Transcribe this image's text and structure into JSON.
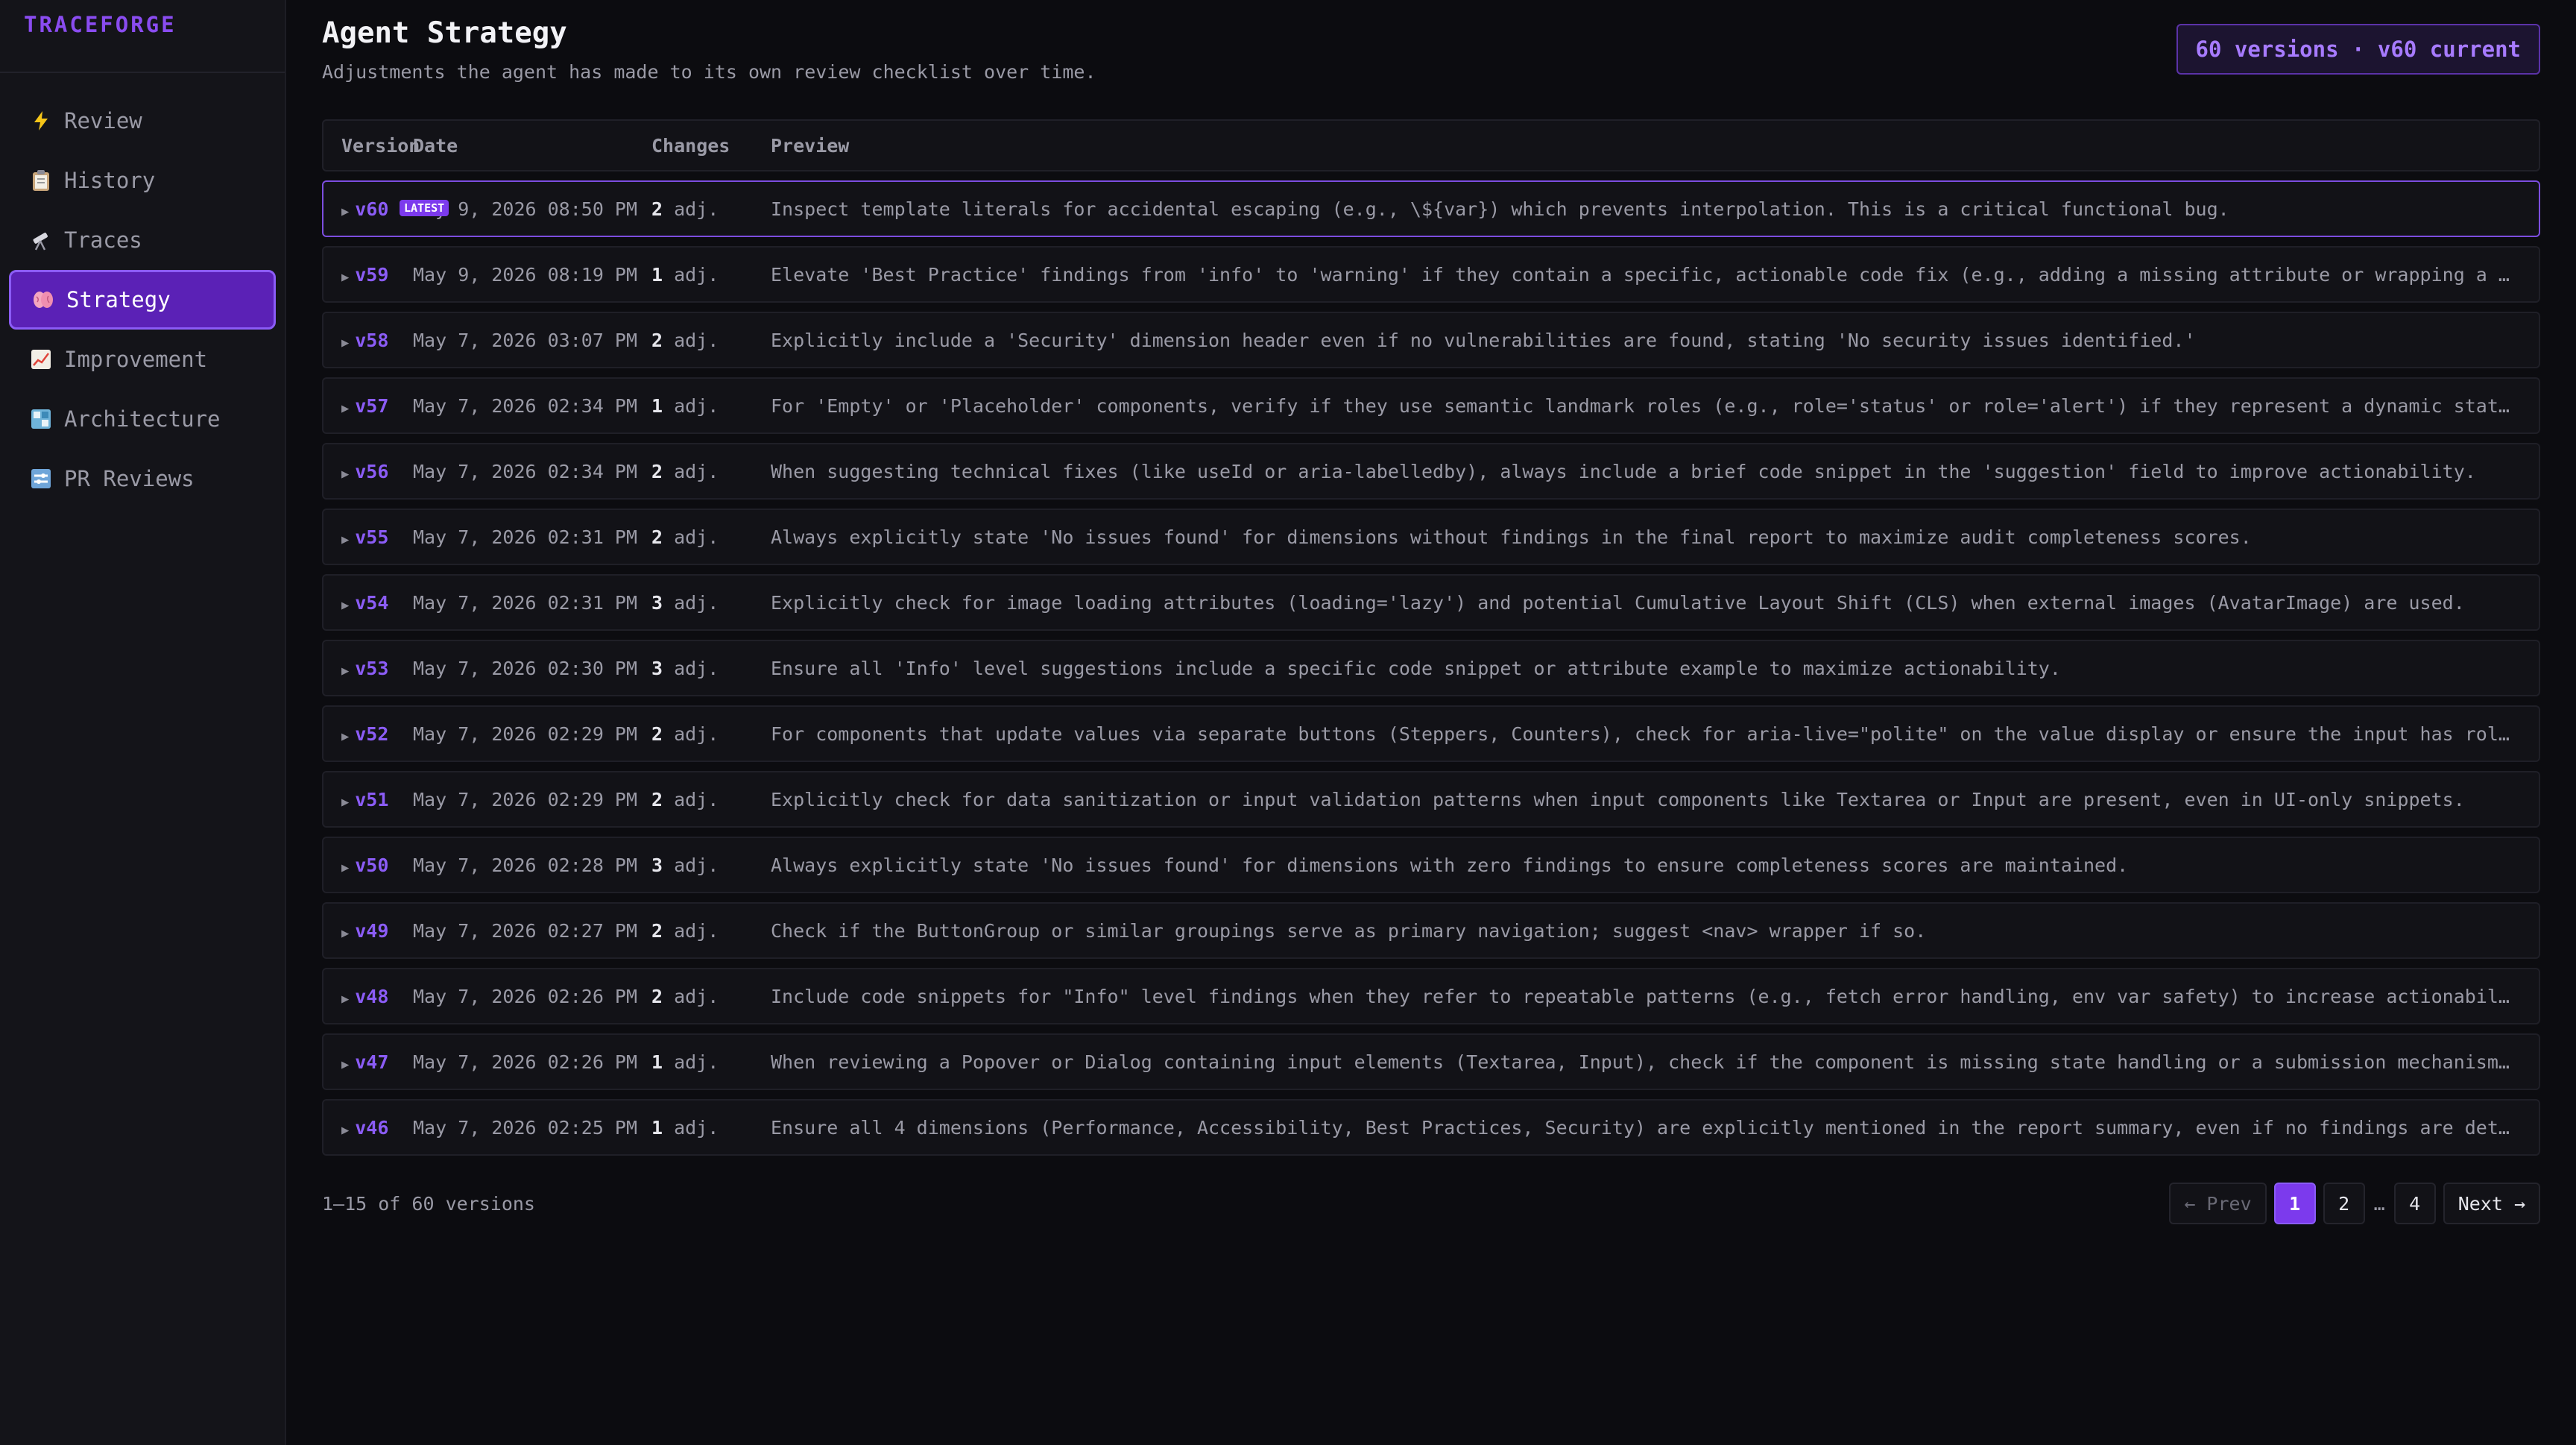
{
  "brand": "TRACEFORGE",
  "nav": [
    {
      "label": "Review",
      "icon": "lightning-icon"
    },
    {
      "label": "History",
      "icon": "clipboard-icon"
    },
    {
      "label": "Traces",
      "icon": "telescope-icon"
    },
    {
      "label": "Strategy",
      "icon": "brain-icon",
      "active": true
    },
    {
      "label": "Improvement",
      "icon": "chart-up-icon"
    },
    {
      "label": "Architecture",
      "icon": "map-icon"
    },
    {
      "label": "PR Reviews",
      "icon": "switch-icon"
    }
  ],
  "header": {
    "title": "Agent Strategy",
    "subtitle": "Adjustments the agent has made to its own review checklist over time.",
    "badge": "60 versions · v60 current"
  },
  "table": {
    "columns": {
      "version": "Version",
      "date": "Date",
      "changes": "Changes",
      "preview": "Preview"
    },
    "latest_label": "LATEST",
    "changes_suffix": "adj.",
    "rows": [
      {
        "version": "v60",
        "date": "May 9, 2026 08:50 PM",
        "changes": "2",
        "preview": "Inspect template literals for accidental escaping (e.g., \\${var}) which prevents interpolation. This is a critical functional bug."
      },
      {
        "version": "v59",
        "date": "May 9, 2026 08:19 PM",
        "changes": "1",
        "preview": "Elevate 'Best Practice' findings from 'info' to 'warning' if they contain a specific, actionable code fix (e.g., adding a missing attribute or wrapping a compo…"
      },
      {
        "version": "v58",
        "date": "May 7, 2026 03:07 PM",
        "changes": "2",
        "preview": "Explicitly include a 'Security' dimension header even if no vulnerabilities are found, stating 'No security issues identified.'"
      },
      {
        "version": "v57",
        "date": "May 7, 2026 02:34 PM",
        "changes": "1",
        "preview": "For 'Empty' or 'Placeholder' components, verify if they use semantic landmark roles (e.g., role='status' or role='alert') if they represent a dynamic state cha…"
      },
      {
        "version": "v56",
        "date": "May 7, 2026 02:34 PM",
        "changes": "2",
        "preview": "When suggesting technical fixes (like useId or aria-labelledby), always include a brief code snippet in the 'suggestion' field to improve actionability."
      },
      {
        "version": "v55",
        "date": "May 7, 2026 02:31 PM",
        "changes": "2",
        "preview": "Always explicitly state 'No issues found' for dimensions without findings in the final report to maximize audit completeness scores."
      },
      {
        "version": "v54",
        "date": "May 7, 2026 02:31 PM",
        "changes": "3",
        "preview": "Explicitly check for image loading attributes (loading='lazy') and potential Cumulative Layout Shift (CLS) when external images (AvatarImage) are used."
      },
      {
        "version": "v53",
        "date": "May 7, 2026 02:30 PM",
        "changes": "3",
        "preview": "Ensure all 'Info' level suggestions include a specific code snippet or attribute example to maximize actionability."
      },
      {
        "version": "v52",
        "date": "May 7, 2026 02:29 PM",
        "changes": "2",
        "preview": "For components that update values via separate buttons (Steppers, Counters), check for aria-live=\"polite\" on the value display or ensure the input has role=\"sp…"
      },
      {
        "version": "v51",
        "date": "May 7, 2026 02:29 PM",
        "changes": "2",
        "preview": "Explicitly check for data sanitization or input validation patterns when input components like Textarea or Input are present, even in UI-only snippets."
      },
      {
        "version": "v50",
        "date": "May 7, 2026 02:28 PM",
        "changes": "3",
        "preview": "Always explicitly state 'No issues found' for dimensions with zero findings to ensure completeness scores are maintained."
      },
      {
        "version": "v49",
        "date": "May 7, 2026 02:27 PM",
        "changes": "2",
        "preview": "Check if the ButtonGroup or similar groupings serve as primary navigation; suggest <nav> wrapper if so."
      },
      {
        "version": "v48",
        "date": "May 7, 2026 02:26 PM",
        "changes": "2",
        "preview": "Include code snippets for \"Info\" level findings when they refer to repeatable patterns (e.g., fetch error handling, env var safety) to increase actionability."
      },
      {
        "version": "v47",
        "date": "May 7, 2026 02:26 PM",
        "changes": "1",
        "preview": "When reviewing a Popover or Dialog containing input elements (Textarea, Input), check if the component is missing state handling or a submission mechanism (e.g…"
      },
      {
        "version": "v46",
        "date": "May 7, 2026 02:25 PM",
        "changes": "1",
        "preview": "Ensure all 4 dimensions (Performance, Accessibility, Best Practices, Security) are explicitly mentioned in the report summary, even if no findings are detected…"
      }
    ]
  },
  "footer": {
    "count": "1–15 of 60 versions",
    "prev": "← Prev",
    "next": "Next →",
    "pages": [
      "1",
      "2",
      "…",
      "4"
    ],
    "current_page": "1"
  },
  "colors": {
    "accent": "#7c3aed",
    "brand": "#8a4cf0",
    "background": "#0c0c10"
  }
}
